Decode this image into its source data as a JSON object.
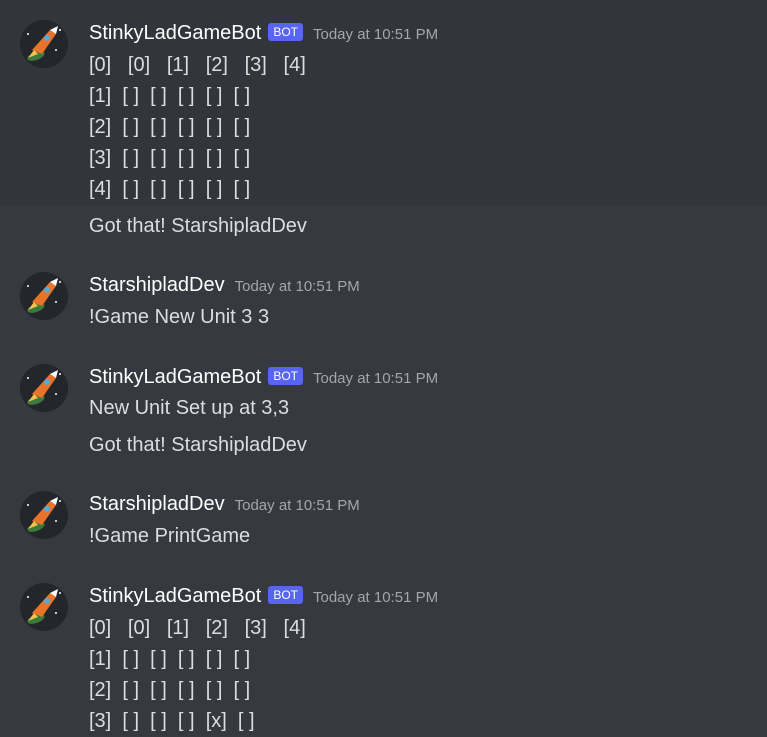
{
  "messages": [
    {
      "author": "StinkyLadGameBot",
      "bot_tag": "BOT",
      "timestamp": "Today at 10:51 PM",
      "lines": [
        "[0]   [0]   [1]   [2]   [3]   [4]",
        "[1]  [ ]  [ ]  [ ]  [ ]  [ ]",
        "[2]  [ ]  [ ]  [ ]  [ ]  [ ]",
        "[3]  [ ]  [ ]  [ ]  [ ]  [ ]",
        "[4]  [ ]  [ ]  [ ]  [ ]  [ ]",
        "Got that! StarshipladDev"
      ]
    },
    {
      "author": "StarshipladDev",
      "timestamp": "Today at 10:51 PM",
      "lines": [
        "!Game New Unit 3 3"
      ]
    },
    {
      "author": "StinkyLadGameBot",
      "bot_tag": "BOT",
      "timestamp": "Today at 10:51 PM",
      "lines": [
        "New Unit Set up at 3,3",
        "Got that! StarshipladDev"
      ]
    },
    {
      "author": "StarshipladDev",
      "timestamp": "Today at 10:51 PM",
      "lines": [
        "!Game PrintGame"
      ]
    },
    {
      "author": "StinkyLadGameBot",
      "bot_tag": "BOT",
      "timestamp": "Today at 10:51 PM",
      "lines": [
        "[0]   [0]   [1]   [2]   [3]   [4]",
        "[1]  [ ]  [ ]  [ ]  [ ]  [ ]",
        "[2]  [ ]  [ ]  [ ]  [ ]  [ ]",
        "[3]  [ ]  [ ]  [ ]  [x]  [ ]"
      ]
    }
  ]
}
